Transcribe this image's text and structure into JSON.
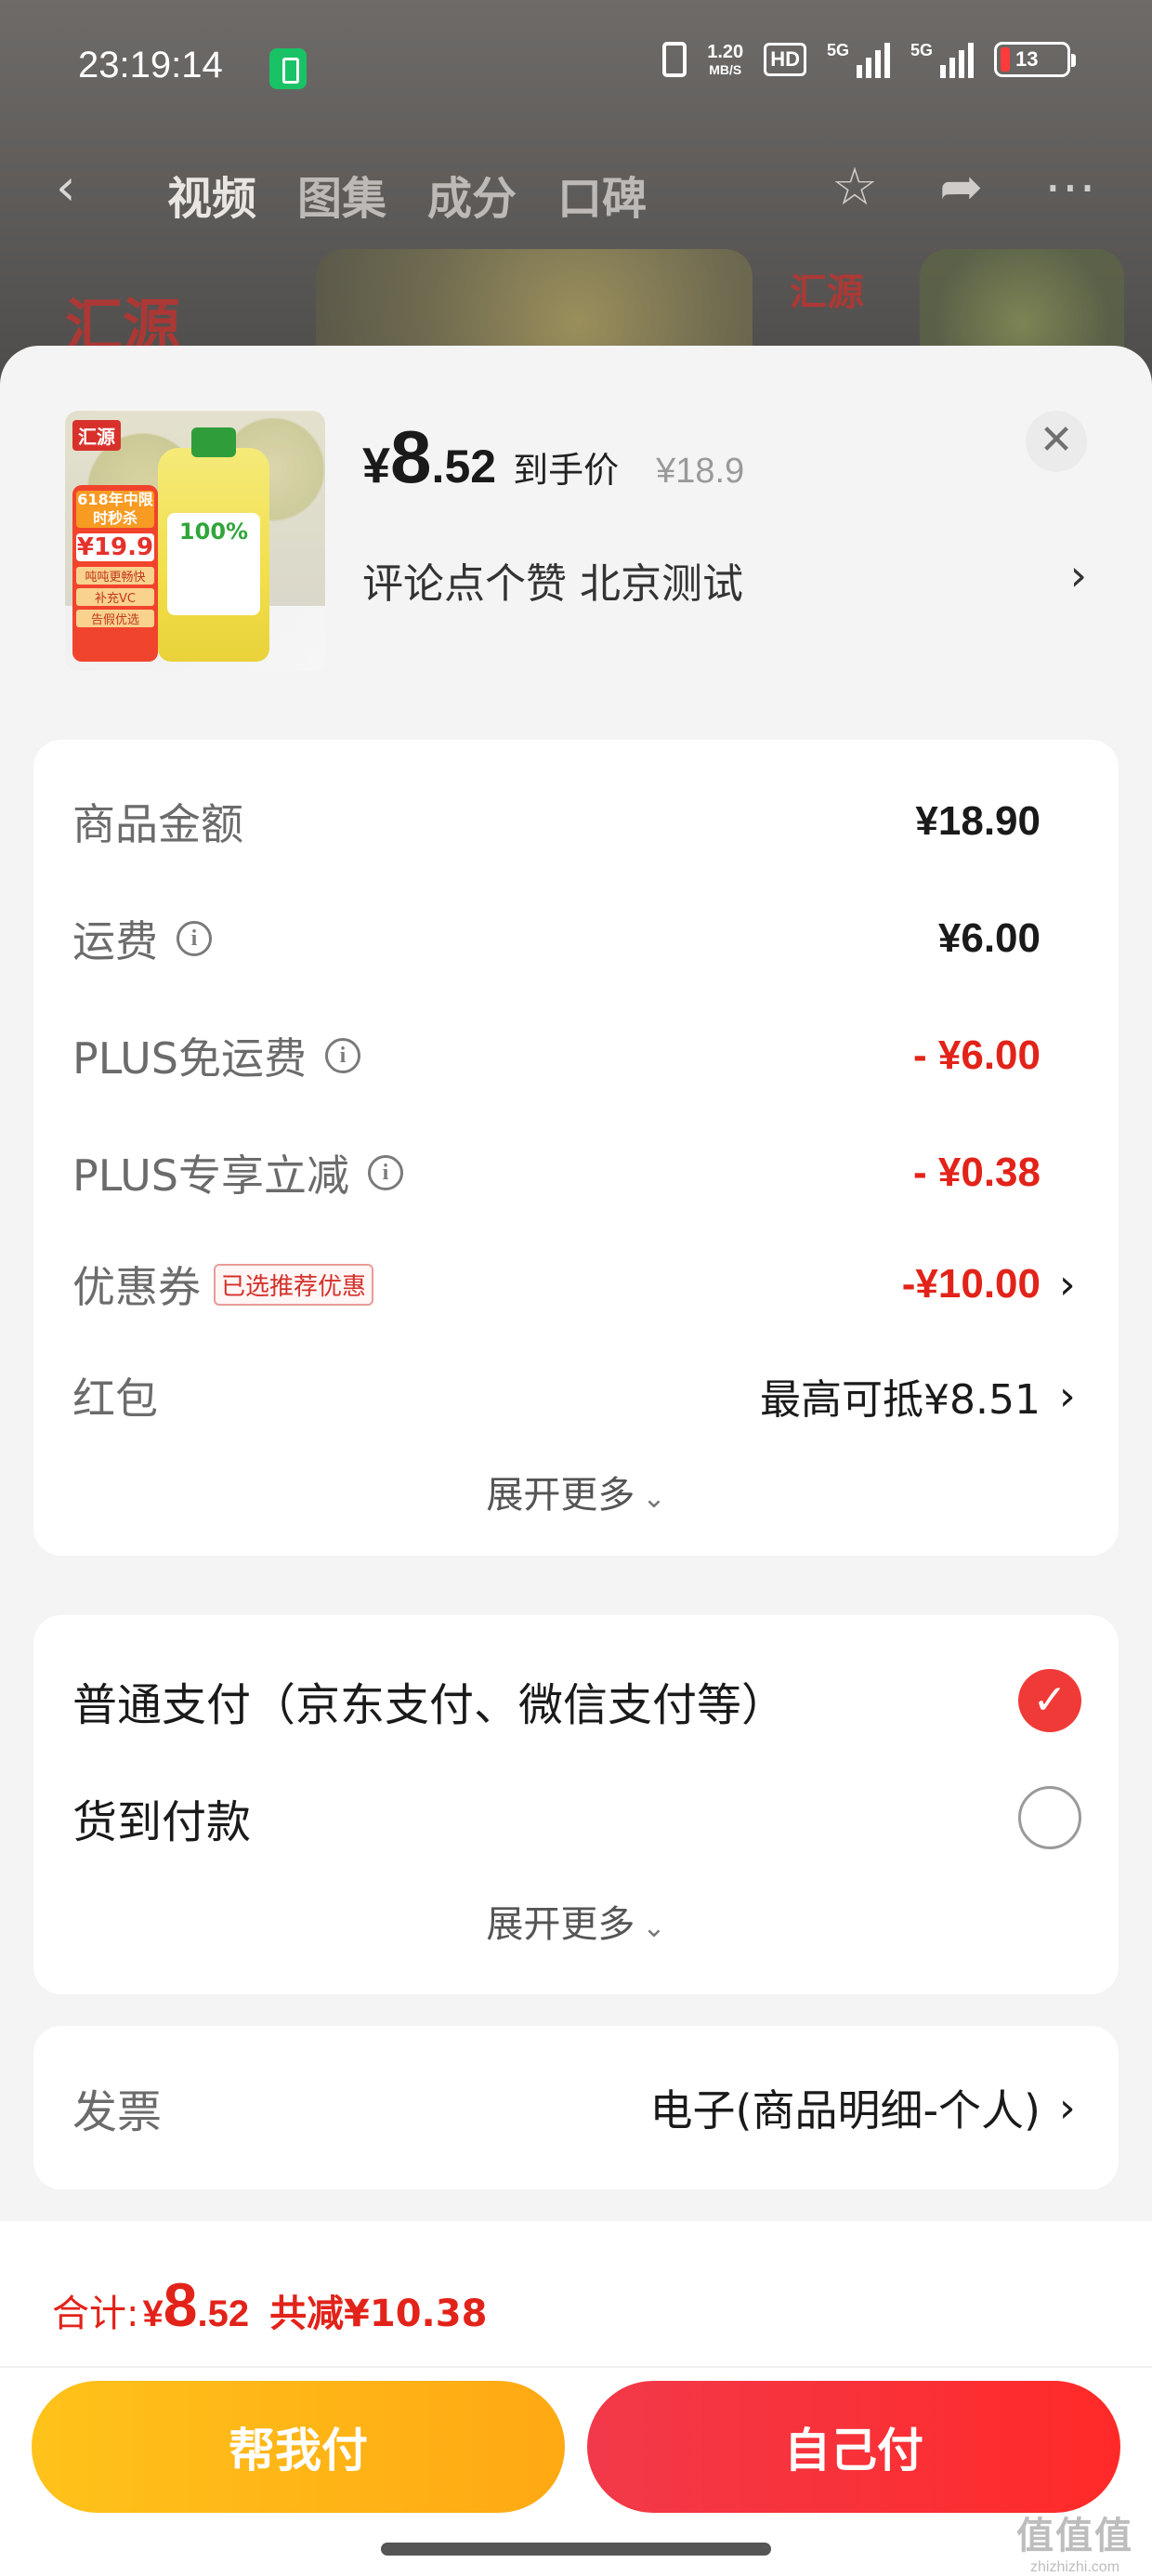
{
  "status_bar": {
    "time": "23:19:14",
    "net_speed_value": "1.20",
    "net_speed_unit": "MB/S",
    "hd_badge": "HD",
    "sim1": "5G",
    "sim2": "5G",
    "battery": "13"
  },
  "nav": {
    "tabs": [
      "视频",
      "图集",
      "成分",
      "口碑"
    ],
    "active_tab": "视频"
  },
  "background": {
    "brand": "汇源"
  },
  "product": {
    "thumb_logo": "汇源",
    "thumb_bottle_text": "100%",
    "thumb_promo_title": "618年中限时秒杀",
    "thumb_promo_price": "¥19.9",
    "thumb_promo_tag1": "吨吨更畅快",
    "thumb_promo_tag2": "补充VC",
    "thumb_promo_tag3": "告假优选",
    "price_currency": "¥",
    "price_integer": "8",
    "price_decimal": ".52",
    "price_label": "到手价",
    "original_price": "¥18.9",
    "address": "评论点个赞  北京测试",
    "close_icon": "close-icon"
  },
  "fees": {
    "rows": [
      {
        "label": "商品金额",
        "value": "¥18.90"
      },
      {
        "label": "运费",
        "value": "¥6.00"
      },
      {
        "label": "PLUS免运费",
        "value": "- ¥6.00"
      },
      {
        "label": "PLUS专享立减",
        "value": "- ¥0.38"
      },
      {
        "label": "优惠券",
        "tag": "已选推荐优惠",
        "value": "-¥10.00"
      },
      {
        "label": "红包",
        "value": "最高可抵¥8.51"
      }
    ],
    "expand_label": "展开更多"
  },
  "payment": {
    "options": [
      {
        "label": "普通支付（京东支付、微信支付等）",
        "selected": true
      },
      {
        "label": "货到付款",
        "selected": false
      }
    ],
    "expand_label": "展开更多"
  },
  "invoice": {
    "label": "发票",
    "value": "电子(商品明细-个人)"
  },
  "footer": {
    "total_label": "合计:",
    "total_currency": "¥",
    "total_integer": "8",
    "total_decimal": ".52",
    "total_saving": "共减¥10.38",
    "help_pay_label": "帮我付",
    "self_pay_label": "自己付",
    "watermark_text": "值值值",
    "watermark_url": "zhizhizhi.com"
  },
  "colors": {
    "accent_red": "#e2231a",
    "help_pay_yellow": "#ffb516",
    "self_pay_red": "#f2394a",
    "sheet_bg": "#f4f4f4"
  }
}
